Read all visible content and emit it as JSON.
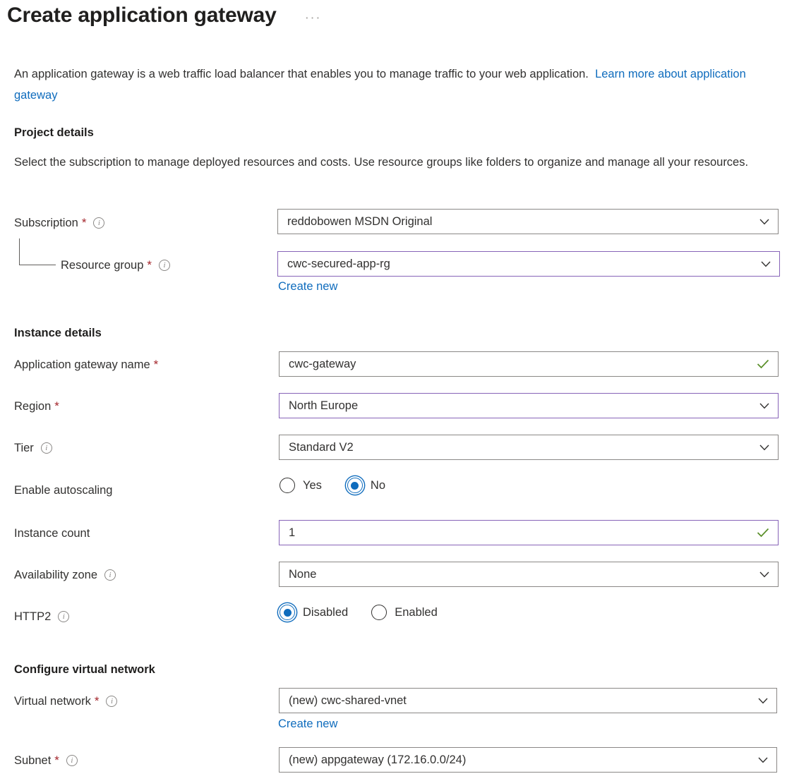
{
  "header": {
    "title": "Create application gateway",
    "more_menu": "···"
  },
  "intro": {
    "text": "An application gateway is a web traffic load balancer that enables you to manage traffic to your web application.",
    "link_text": "Learn more about application gateway"
  },
  "project_details": {
    "heading": "Project details",
    "description": "Select the subscription to manage deployed resources and costs. Use resource groups like folders to organize and manage all your resources.",
    "subscription": {
      "label": "Subscription",
      "required": "*",
      "value": "reddobowen MSDN Original"
    },
    "resource_group": {
      "label": "Resource group",
      "required": "*",
      "value": "cwc-secured-app-rg",
      "create_new": "Create new"
    }
  },
  "instance_details": {
    "heading": "Instance details",
    "gateway_name": {
      "label": "Application gateway name",
      "required": "*",
      "value": "cwc-gateway"
    },
    "region": {
      "label": "Region",
      "required": "*",
      "value": "North Europe"
    },
    "tier": {
      "label": "Tier",
      "value": "Standard V2"
    },
    "autoscaling": {
      "label": "Enable autoscaling",
      "options": [
        "Yes",
        "No"
      ],
      "selected": "No"
    },
    "instance_count": {
      "label": "Instance count",
      "value": "1"
    },
    "availability_zone": {
      "label": "Availability zone",
      "value": "None"
    },
    "http2": {
      "label": "HTTP2",
      "options": [
        "Disabled",
        "Enabled"
      ],
      "selected": "Disabled"
    }
  },
  "virtual_network": {
    "heading": "Configure virtual network",
    "vnet": {
      "label": "Virtual network",
      "required": "*",
      "value": "(new) cwc-shared-vnet",
      "create_new": "Create new"
    },
    "subnet": {
      "label": "Subnet",
      "required": "*",
      "value": "(new) appgateway (172.16.0.0/24)"
    }
  },
  "colors": {
    "link": "#0f6cbd",
    "required_asterisk": "#a4262c",
    "focus_border": "#8764b8",
    "valid_check": "#5a8f29",
    "radio_accent": "#0f6cbd"
  }
}
